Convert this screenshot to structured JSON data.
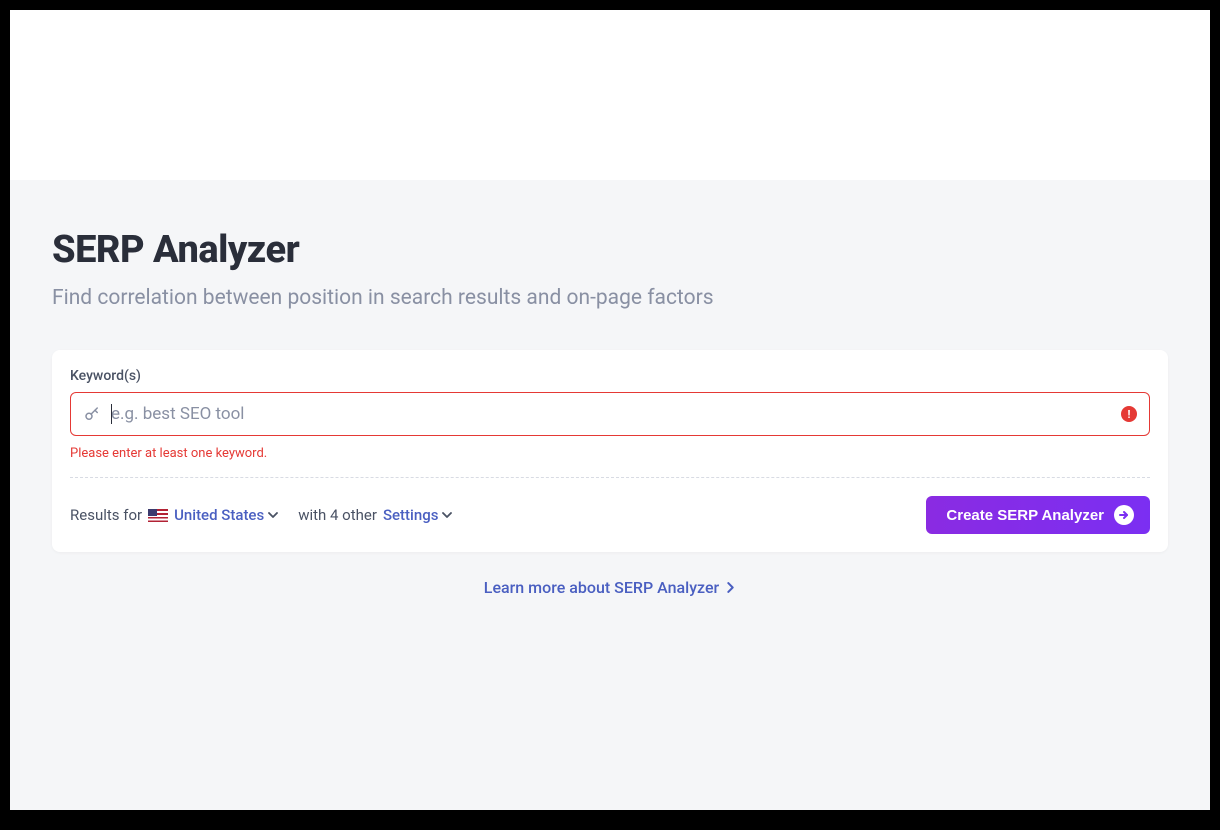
{
  "header": {
    "title": "SERP Analyzer",
    "subtitle": "Find correlation between position in search results and on-page factors"
  },
  "form": {
    "keyword_label": "Keyword(s)",
    "keyword_placeholder": "e.g. best SEO tool",
    "keyword_value": "",
    "error_message": "Please enter at least one keyword."
  },
  "settings": {
    "results_for_prefix": "Results for",
    "country": "United States",
    "with_text": "with 4 other",
    "settings_label": "Settings"
  },
  "actions": {
    "create_button": "Create SERP Analyzer"
  },
  "footer": {
    "learn_more": "Learn more about SERP Analyzer"
  }
}
